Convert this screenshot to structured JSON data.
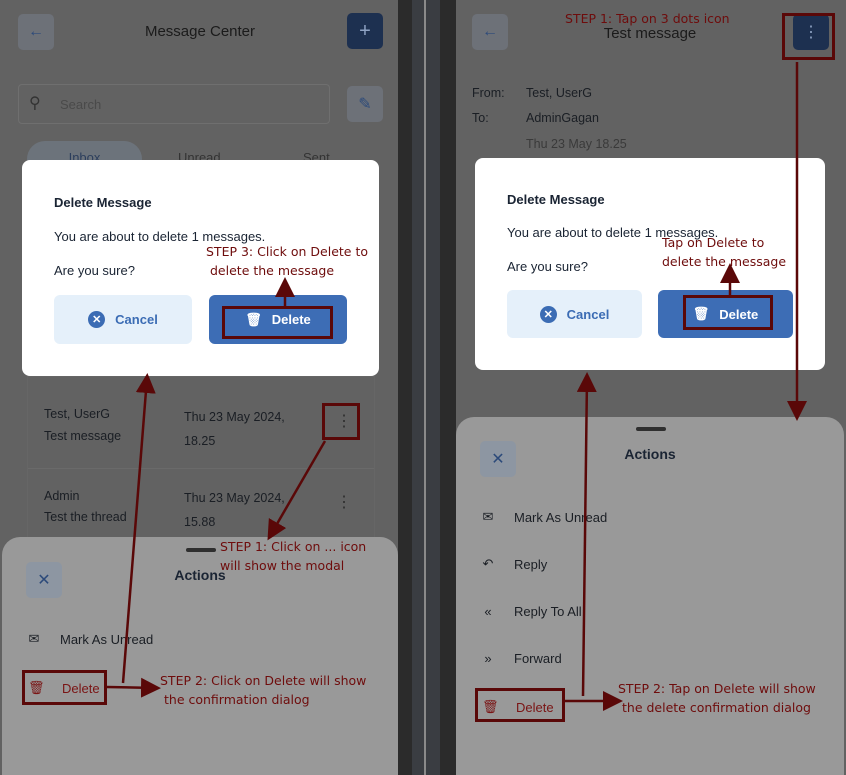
{
  "left_screen": {
    "header": {
      "title": "Message Center",
      "back_icon": "arrow-left-icon",
      "add_icon": "plus-icon"
    },
    "search": {
      "placeholder": "Search",
      "compose_icon": "pencil-icon"
    },
    "tabs": [
      {
        "label": "Inbox",
        "active": true
      },
      {
        "label": "Unread"
      },
      {
        "label": "Sent"
      }
    ],
    "messages": [
      {
        "sender": "Test, UserG",
        "subject": "Test message",
        "date": "Thu 23 May 2024,",
        "time": "18.25"
      },
      {
        "sender": "Admin",
        "subject": "Test the thread",
        "date": "Thu 23 May 2024,",
        "time": "15.88"
      }
    ],
    "dialog": {
      "title": "Delete Message",
      "body": "You are about to delete 1 messages.",
      "question": "Are you sure?",
      "cancel": "Cancel",
      "delete": "Delete"
    },
    "sheet": {
      "title": "Actions",
      "items": [
        {
          "label": "Mark As Unread",
          "icon": "mail-unread-icon"
        },
        {
          "label": "Delete",
          "icon": "trash-icon",
          "danger": true
        }
      ]
    },
    "annotations": {
      "step1": [
        "STEP 1: Click on ... icon",
        "will show the modal"
      ],
      "step2": [
        "STEP 2: Click on Delete will show",
        "the confirmation dialog"
      ],
      "step3": [
        "STEP 3: Click on Delete to",
        "delete the message"
      ]
    }
  },
  "right_screen": {
    "header": {
      "title": "Test message",
      "back_icon": "arrow-left-icon",
      "menu_icon": "more-vertical-icon"
    },
    "details": {
      "from_label": "From:",
      "from": "Test, UserG",
      "to_label": "To:",
      "to": "AdminGagan",
      "date": "Thu 23 May 18.25"
    },
    "dialog": {
      "title": "Delete Message",
      "body": "You are about to delete 1 messages.",
      "question": "Are you sure?",
      "cancel": "Cancel",
      "delete": "Delete"
    },
    "sheet": {
      "title": "Actions",
      "items": [
        {
          "label": "Mark As Unread",
          "icon": "mail-unread-icon"
        },
        {
          "label": "Reply",
          "icon": "reply-icon"
        },
        {
          "label": "Reply To All",
          "icon": "reply-all-icon"
        },
        {
          "label": "Forward",
          "icon": "forward-icon"
        },
        {
          "label": "Delete",
          "icon": "trash-icon",
          "danger": true
        }
      ]
    },
    "annotations": {
      "step1": "STEP 1: Tap on 3 dots icon",
      "step2": [
        "STEP 2: Tap on Delete will show",
        "the delete confirmation dialog"
      ],
      "step3": [
        "Tap on Delete to",
        "delete the message"
      ]
    }
  },
  "colors": {
    "primary": "#3d6db5",
    "danger": "#8b1a1a",
    "annotation": "#6e0c0c"
  }
}
